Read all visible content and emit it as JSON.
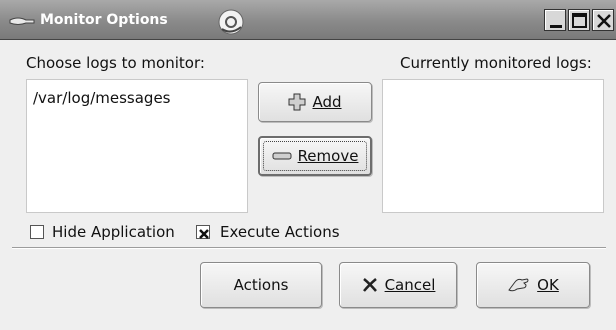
{
  "window": {
    "title": "Monitor Options"
  },
  "labels": {
    "choose_logs": "Choose logs to monitor:",
    "currently_monitored": "Currently monitored logs:"
  },
  "available_logs": [
    "/var/log/messages"
  ],
  "monitored_logs": [],
  "buttons": {
    "add": "Add",
    "remove": "Remove",
    "actions": "Actions",
    "cancel": "Cancel",
    "ok": "OK"
  },
  "checkboxes": {
    "hide_application": {
      "label": "Hide Application",
      "checked": false
    },
    "execute_actions": {
      "label": "Execute Actions",
      "checked": true
    }
  },
  "icons": {
    "add": "plus-icon",
    "remove": "minus-icon",
    "cancel": "x-icon",
    "ok": "hand-ok-icon"
  },
  "colors": {
    "titlebar": "#8a8a8a",
    "dialog_bg": "#efefef",
    "list_bg": "#ffffff"
  }
}
